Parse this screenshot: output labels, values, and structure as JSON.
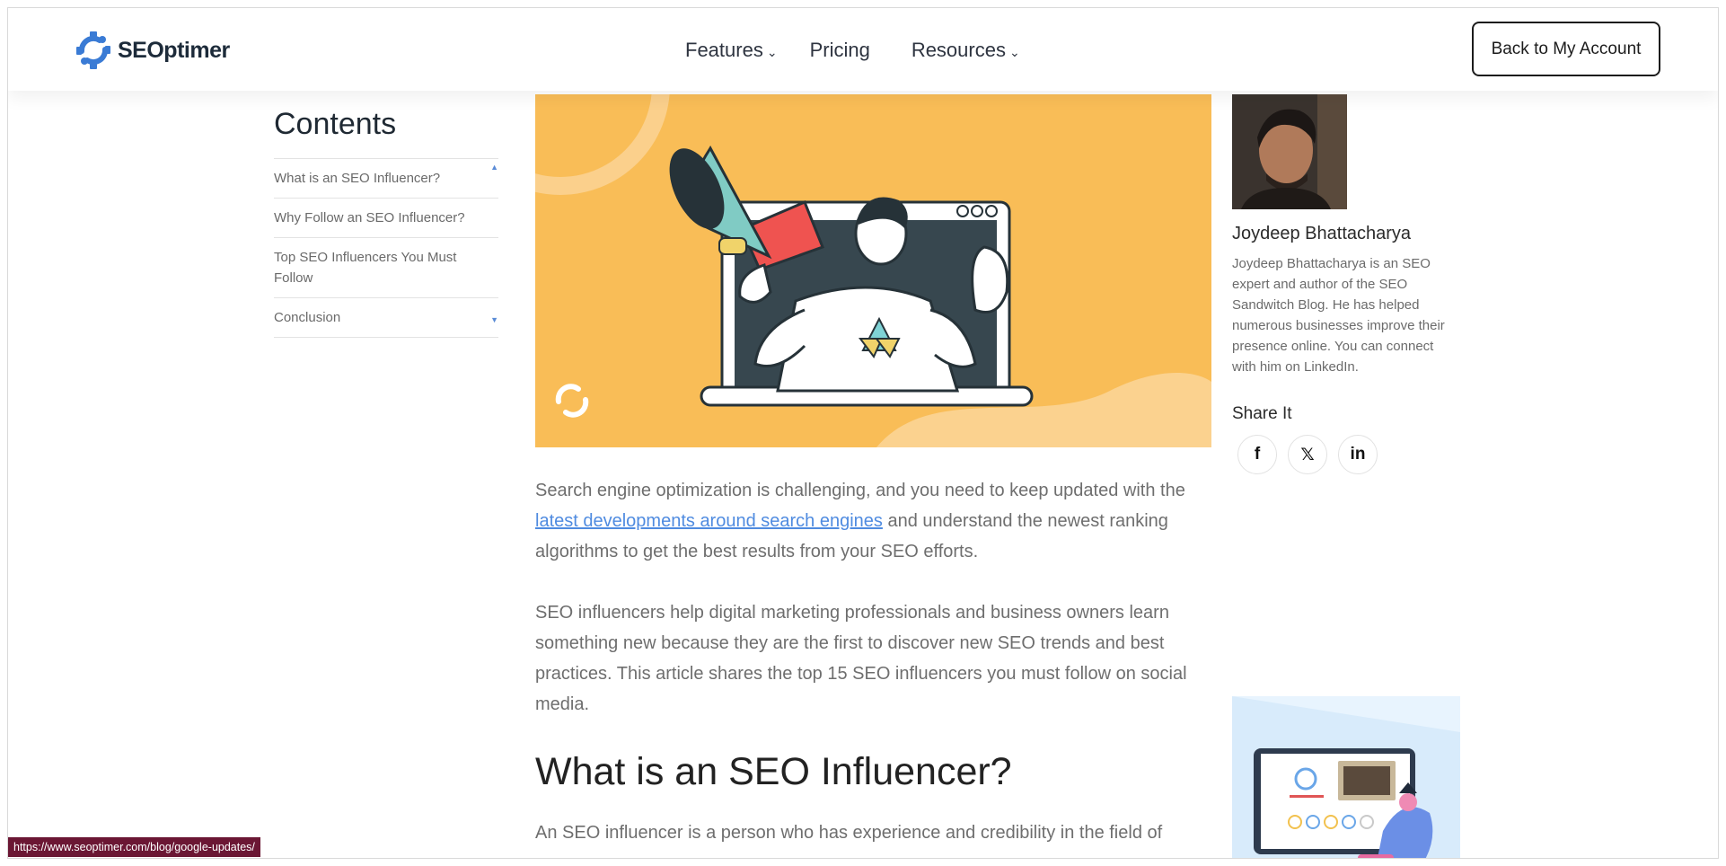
{
  "header": {
    "logo_text": "SEOptimer",
    "nav": {
      "features": "Features",
      "pricing": "Pricing",
      "resources": "Resources"
    },
    "back_button": "Back to My Account"
  },
  "toc": {
    "title": "Contents",
    "items": [
      "What is an SEO Influencer?",
      "Why Follow an SEO Influencer?",
      "Top SEO Influencers You Must Follow",
      "Conclusion"
    ]
  },
  "article": {
    "p1_before": "Search engine optimization is challenging, and you need to keep updated with the ",
    "p1_link": "latest developments around search engines",
    "p1_after": " and understand the newest ranking algorithms to get the best results from your SEO efforts.",
    "p2": "SEO influencers help digital marketing professionals and business owners learn something new because they are the first to discover new SEO trends and best practices. This article shares the top 15 SEO influencers you must follow on social media.",
    "h2": "What is an SEO Influencer?",
    "p3": "An SEO influencer is a person who has experience and credibility in the field of"
  },
  "author": {
    "name": "Joydeep Bhattacharya",
    "bio": "Joydeep Bhattacharya is an SEO expert and author of the SEO Sandwitch Blog. He has helped numerous businesses improve their presence online. You can connect with him on LinkedIn.",
    "share_title": "Share It",
    "share": {
      "facebook": "f",
      "x": "𝕏",
      "linkedin": "in"
    }
  },
  "status_bar": {
    "url": "https://www.seoptimer.com/blog/google-updates/"
  },
  "colors": {
    "accent": "#4f8be0",
    "hero_bg": "#f9bd57",
    "status_bg": "#6b1734"
  }
}
